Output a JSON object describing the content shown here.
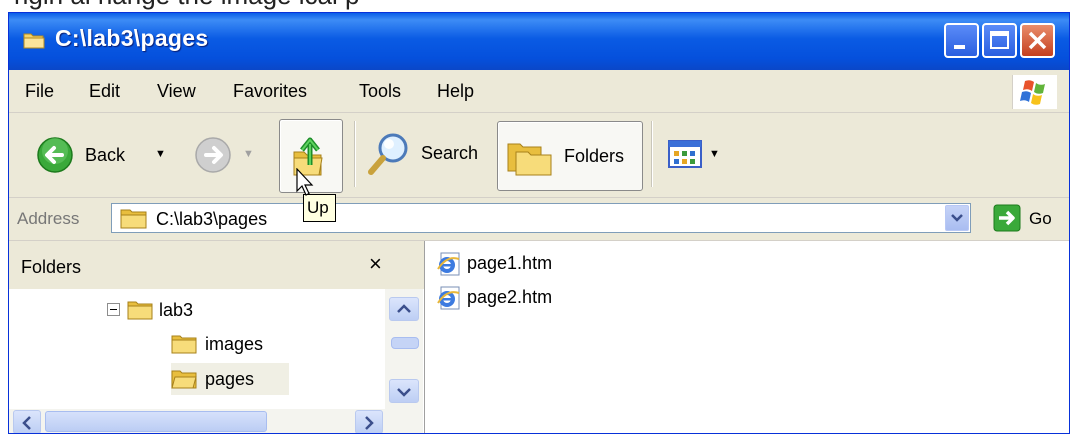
{
  "page_top_text": "rigin al           hange  the  lmage  lcal  p   ",
  "window": {
    "title": "C:\\lab3\\pages",
    "colors": {
      "titlebar": "#0a5be4",
      "frame": "#ece9d8",
      "close_button": "#c5401f"
    }
  },
  "menu": [
    "File",
    "Edit",
    "View",
    "Favorites",
    "Tools",
    "Help"
  ],
  "toolbar": {
    "back_label": "Back",
    "search_label": "Search",
    "folders_label": "Folders"
  },
  "address": {
    "label": "Address",
    "value": "C:\\lab3\\pages",
    "go_label": "Go"
  },
  "tooltip": "Up",
  "folders_pane": {
    "title": "Folders",
    "close": "×",
    "tree": [
      {
        "label": "lab3",
        "expanded": true
      },
      {
        "label": "images"
      },
      {
        "label": "pages",
        "selected": true
      }
    ]
  },
  "files": [
    {
      "name": "page1.htm",
      "icon": "ie-document-icon"
    },
    {
      "name": "page2.htm",
      "icon": "ie-document-icon"
    }
  ]
}
